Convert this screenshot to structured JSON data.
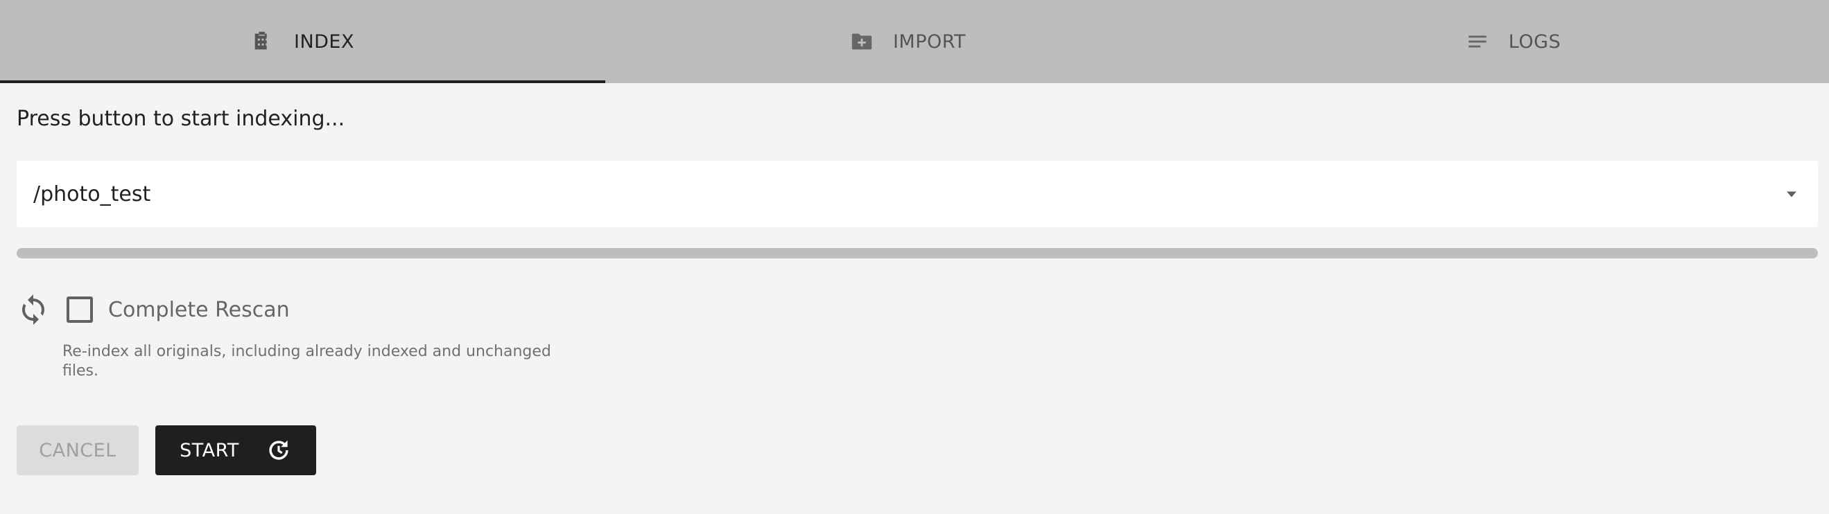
{
  "tabs": [
    {
      "label": "INDEX",
      "icon": "film-folder-icon",
      "active": true
    },
    {
      "label": "IMPORT",
      "icon": "folder-plus-icon",
      "active": false
    },
    {
      "label": "LOGS",
      "icon": "notes-icon",
      "active": false
    }
  ],
  "index": {
    "status_text": "Press button to start indexing...",
    "folder_select": {
      "value": "/photo_test"
    },
    "progress": 0,
    "complete_rescan": {
      "label": "Complete Rescan",
      "checked": false,
      "icon": "sync-icon",
      "hint": "Re-index all originals, including already indexed and unchanged files."
    },
    "buttons": {
      "cancel_label": "CANCEL",
      "start_label": "START",
      "start_icon": "update-icon"
    }
  },
  "colors": {
    "tab_bar": "#bdbdbd",
    "background": "#f4f4f4",
    "primary_button": "#1f1f1f",
    "active_tab_indicator": "#1f1f1f"
  }
}
